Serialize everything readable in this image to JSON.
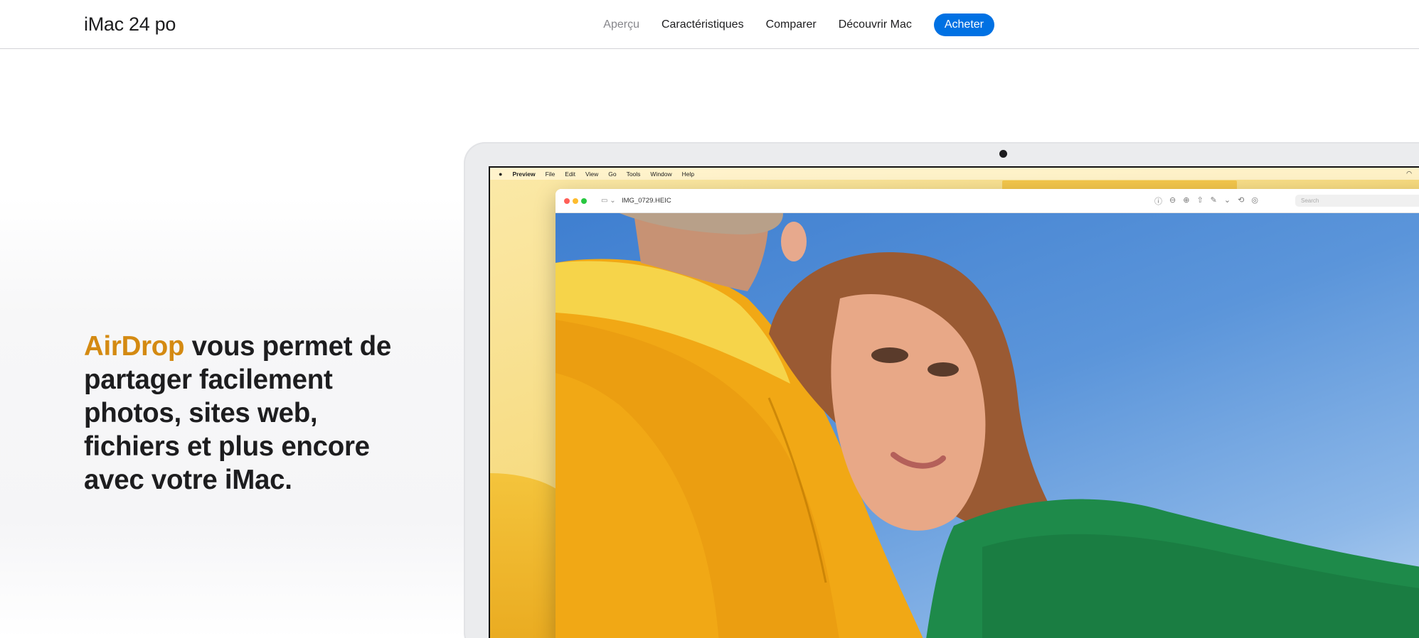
{
  "localnav": {
    "title": "iMac 24 po",
    "menu": [
      {
        "label": "Aperçu",
        "current": true
      },
      {
        "label": "Caractéristiques",
        "current": false
      },
      {
        "label": "Comparer",
        "current": false
      },
      {
        "label": "Découvrir Mac",
        "current": false
      }
    ],
    "buy_label": "Acheter",
    "buy_color": "#0071e3"
  },
  "headline": {
    "accent": "AirDrop",
    "rest": " vous permet de partager facilement photos, sites web, fichiers et plus encore avec votre iMac.",
    "accent_color": "#d48a12"
  },
  "screen": {
    "menubar": {
      "apple_icon": "apple-logo-icon",
      "app_name": "Preview",
      "items": [
        "File",
        "Edit",
        "View",
        "Go",
        "Tools",
        "Window",
        "Help"
      ]
    },
    "window": {
      "filename": "IMG_0729.HEIC",
      "search_placeholder": "Search"
    }
  }
}
